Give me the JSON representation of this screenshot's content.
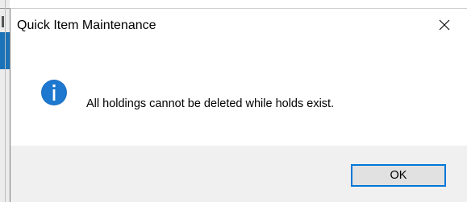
{
  "dialog": {
    "title": "Quick Item Maintenance",
    "message": "All holdings cannot be deleted while holds exist.",
    "icon": "info-icon",
    "ok_label": "OK",
    "close_icon": "close-icon"
  },
  "colors": {
    "accent": "#0078d7",
    "info_icon": "#1a6fc2",
    "footer_bg": "#f0f0f0",
    "button_bg": "#e1e1e1"
  }
}
